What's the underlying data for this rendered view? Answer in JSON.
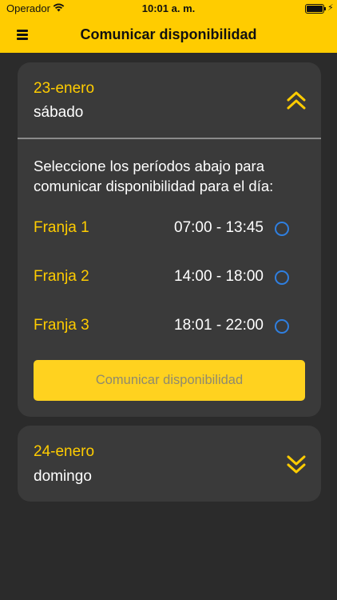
{
  "status_bar": {
    "carrier": "Operador",
    "time": "10:01 a. m.",
    "charging_symbol": "⚡"
  },
  "header": {
    "title": "Comunicar disponibilidad",
    "menu_icon": "hamburger-menu-icon"
  },
  "colors": {
    "accent": "#ffcc00",
    "background": "#2b2b2b",
    "card": "#3a3a3a",
    "radio": "#2f7fe0"
  },
  "days": [
    {
      "date": "23-enero",
      "weekday": "sábado",
      "expanded": true,
      "instructions": "Seleccione los períodos abajo para comunicar disponibilidad para el día:",
      "slots": [
        {
          "name": "Franja 1",
          "time": "07:00 - 13:45",
          "selected": false
        },
        {
          "name": "Franja 2",
          "time": "14:00 - 18:00",
          "selected": false
        },
        {
          "name": "Franja 3",
          "time": "18:01 - 22:00",
          "selected": false
        }
      ],
      "submit_label": "Comunicar disponibilidad"
    },
    {
      "date": "24-enero",
      "weekday": "domingo",
      "expanded": false
    }
  ]
}
